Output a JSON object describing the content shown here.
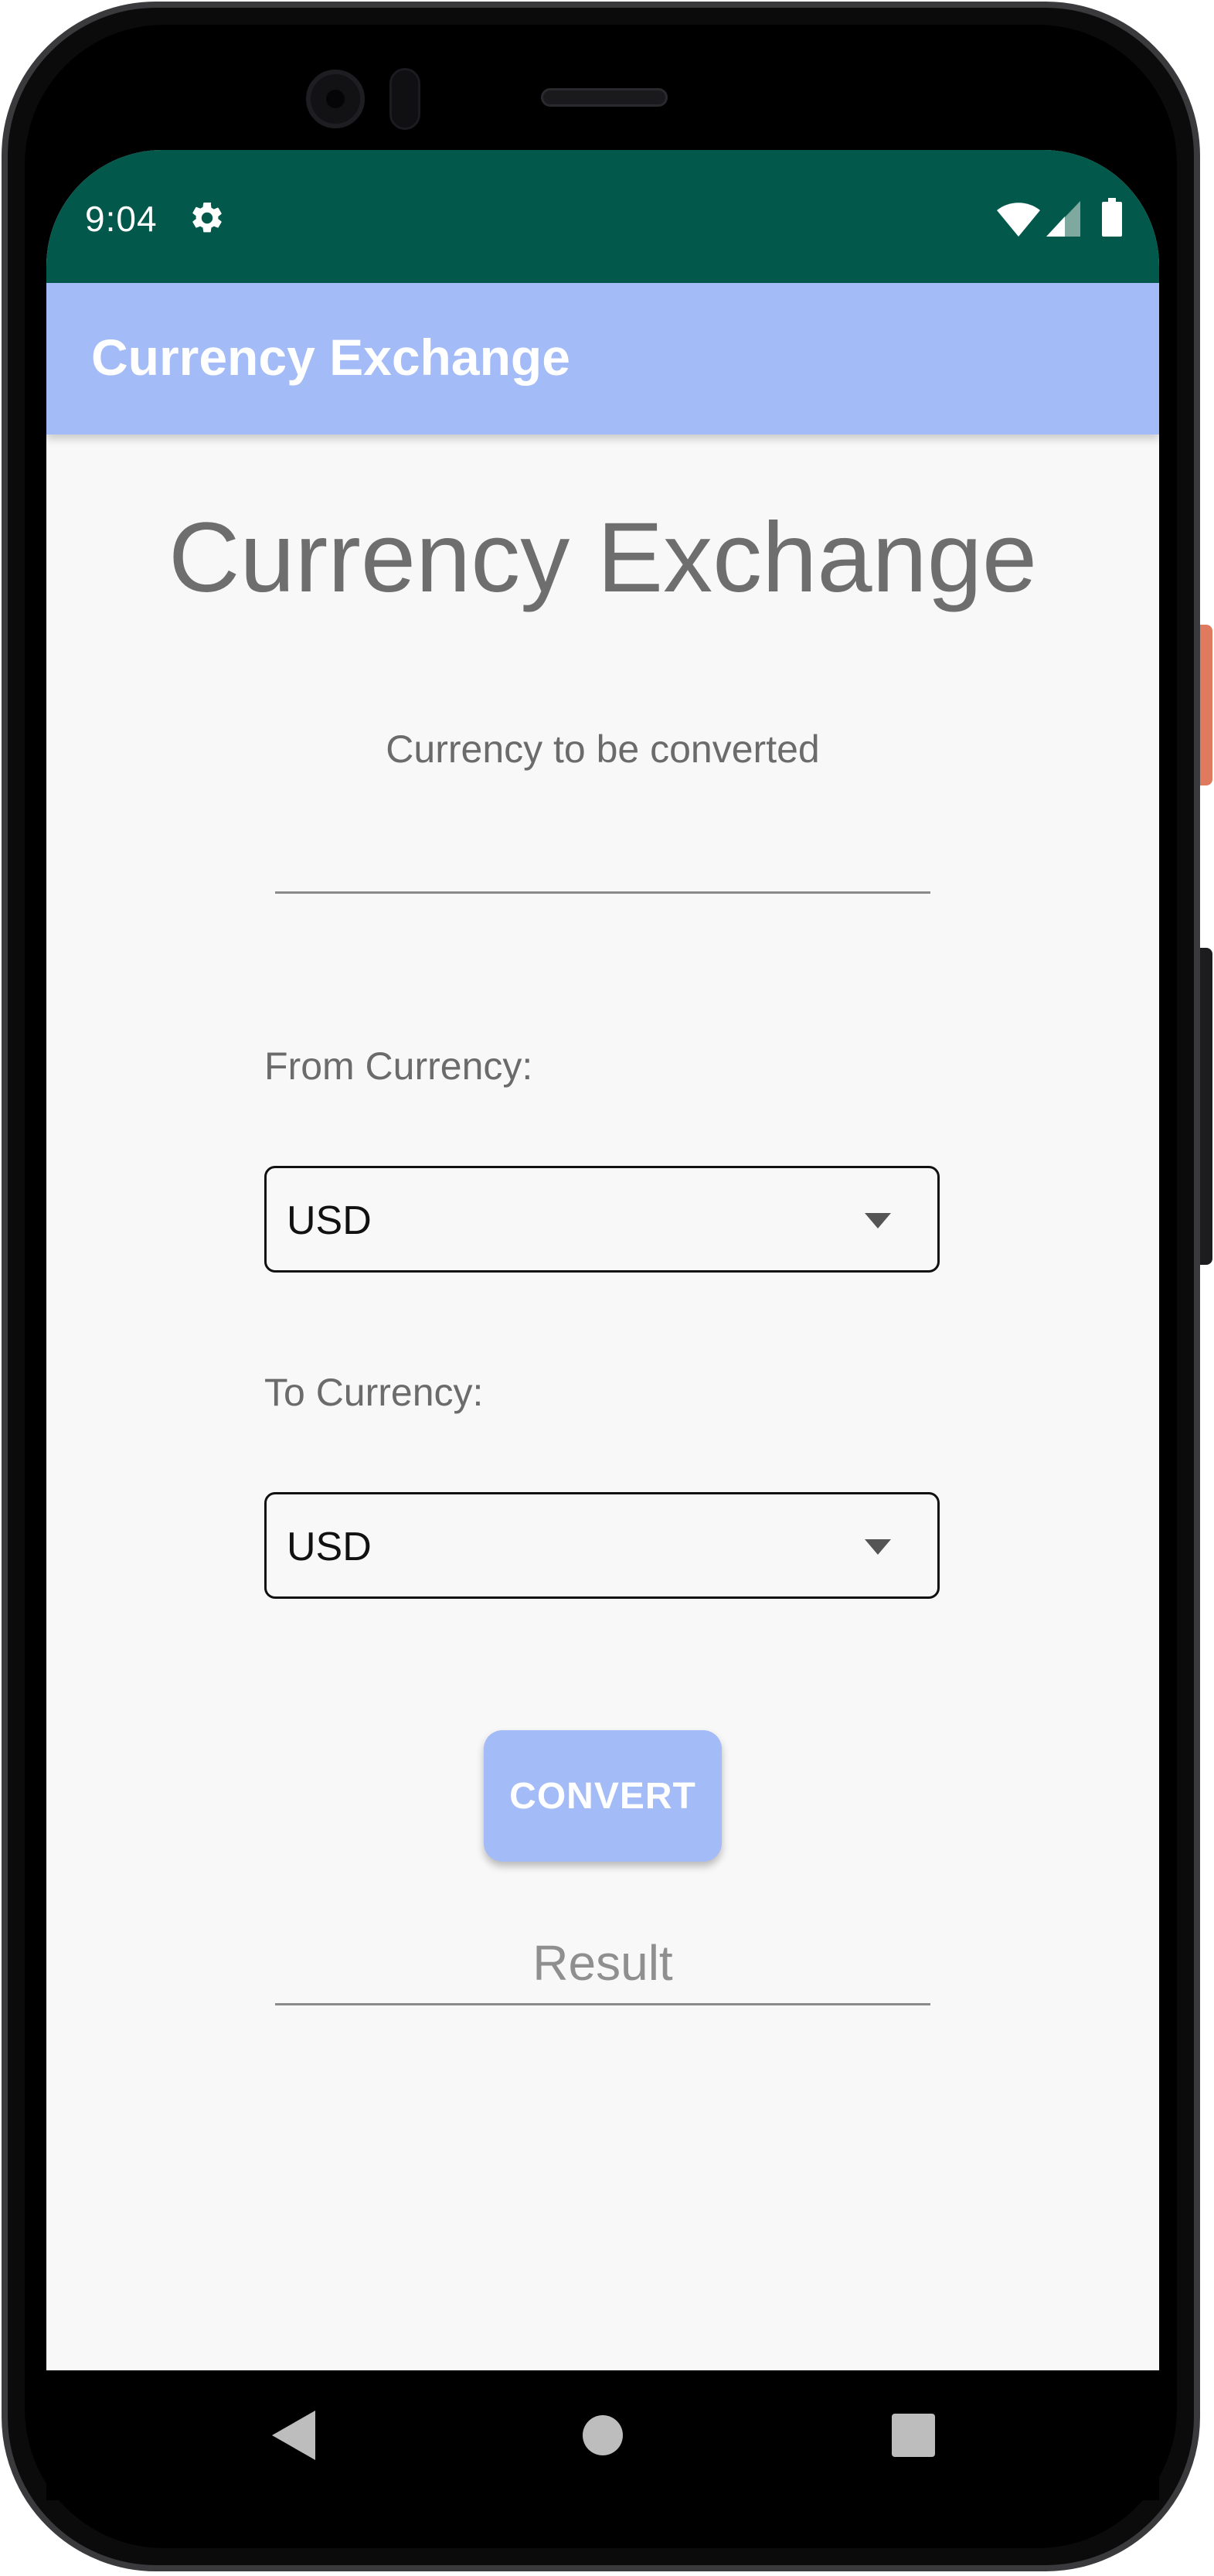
{
  "status_bar": {
    "time": "9:04",
    "icons": [
      "gear-icon",
      "wifi-icon",
      "signal-icon",
      "battery-icon"
    ],
    "background_color": "#02584a"
  },
  "app_bar": {
    "title": "Currency Exchange",
    "background_color": "#a3bbf6"
  },
  "main": {
    "heading": "Currency Exchange",
    "amount_label": "Currency to be converted",
    "amount_value": "",
    "from_label": "From Currency:",
    "from_value": "USD",
    "to_label": "To Currency:",
    "to_value": "USD",
    "convert_label": "CONVERT",
    "result_placeholder": "Result"
  },
  "nav_bar": {
    "icons": [
      "back-icon",
      "home-icon",
      "recents-icon"
    ]
  },
  "device": {
    "side_button_color": "#e07a5f"
  }
}
